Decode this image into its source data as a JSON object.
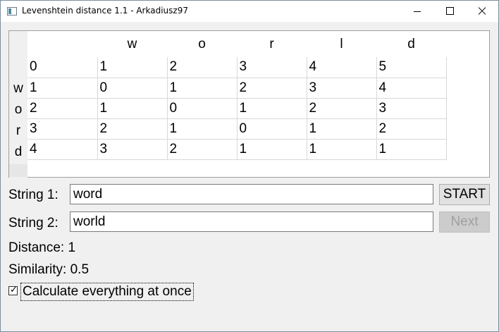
{
  "window": {
    "title": "Levenshtein distance 1.1 - Arkadiusz97"
  },
  "matrix": {
    "col_headers": [
      "",
      "w",
      "o",
      "r",
      "l",
      "d"
    ],
    "row_labels": [
      "",
      "w",
      "o",
      "r",
      "d"
    ],
    "rows": [
      [
        "0",
        "1",
        "2",
        "3",
        "4",
        "5"
      ],
      [
        "1",
        "0",
        "1",
        "2",
        "3",
        "4"
      ],
      [
        "2",
        "1",
        "0",
        "1",
        "2",
        "3"
      ],
      [
        "3",
        "2",
        "1",
        "0",
        "1",
        "2"
      ],
      [
        "4",
        "3",
        "2",
        "1",
        "1",
        "1"
      ]
    ]
  },
  "form": {
    "string1_label": "String 1:",
    "string1_value": "word",
    "string2_label": "String 2:",
    "string2_value": "world",
    "start_label": "START",
    "next_label": "Next",
    "distance_text": "Distance: 1",
    "similarity_text": "Similarity: 0.5",
    "checkbox_label": "Calculate everything at once",
    "checkbox_checked": true
  }
}
